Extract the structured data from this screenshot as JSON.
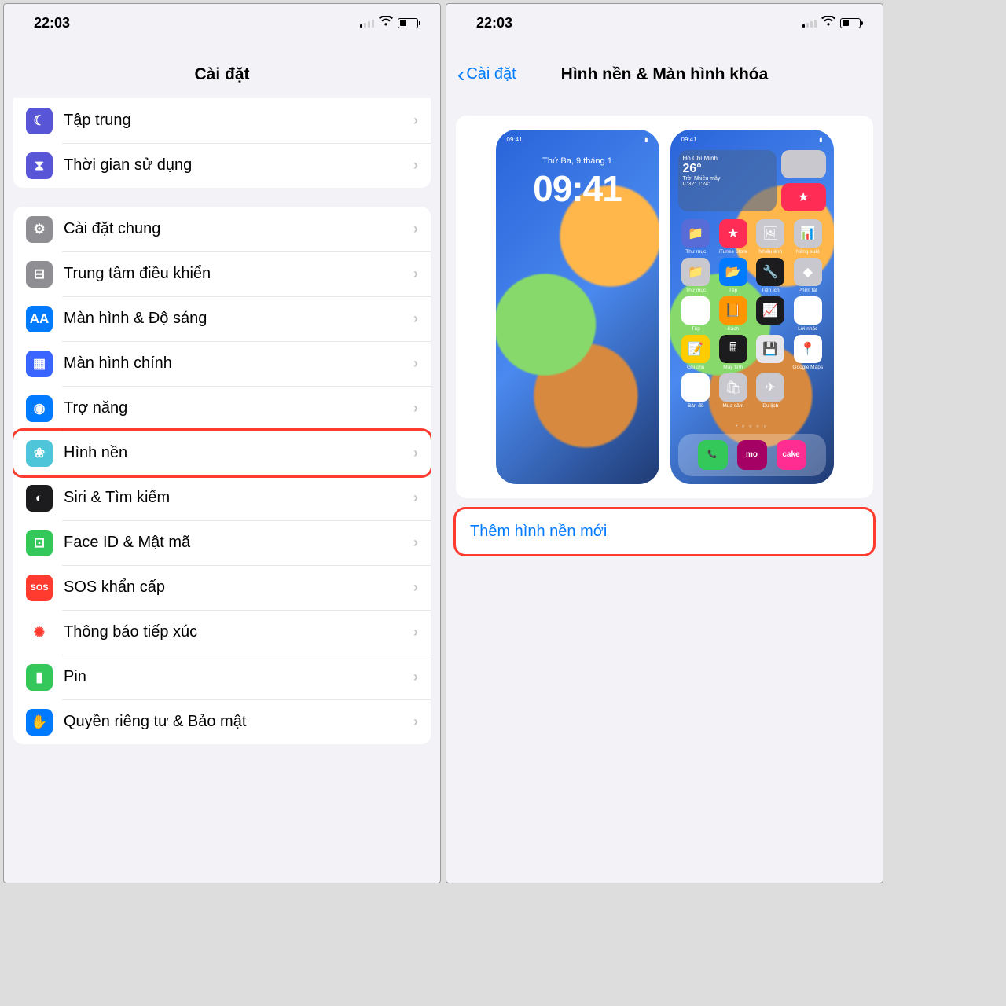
{
  "status": {
    "time": "22:03"
  },
  "left": {
    "title": "Cài đặt",
    "group1": [
      {
        "label": "Tập trung",
        "icon": "moon-icon",
        "bg": "#5856d6",
        "glyph": "☾"
      },
      {
        "label": "Thời gian sử dụng",
        "icon": "hourglass-icon",
        "bg": "#5856d6",
        "glyph": "⧗"
      }
    ],
    "group2": [
      {
        "label": "Cài đặt chung",
        "icon": "gear-icon",
        "bg": "#8e8e93",
        "glyph": "⚙"
      },
      {
        "label": "Trung tâm điều khiển",
        "icon": "switches-icon",
        "bg": "#8e8e93",
        "glyph": "⊟"
      },
      {
        "label": "Màn hình & Độ sáng",
        "icon": "text-size-icon",
        "bg": "#007aff",
        "glyph": "AA"
      },
      {
        "label": "Màn hình chính",
        "icon": "grid-icon",
        "bg": "#3a66ff",
        "glyph": "▦"
      },
      {
        "label": "Trợ năng",
        "icon": "accessibility-icon",
        "bg": "#007aff",
        "glyph": "◉"
      },
      {
        "label": "Hình nền",
        "icon": "wallpaper-icon",
        "bg": "#4fc5d9",
        "glyph": "❀",
        "highlighted": true
      },
      {
        "label": "Siri & Tìm kiếm",
        "icon": "siri-icon",
        "bg": "#1c1c1e",
        "glyph": "◐"
      },
      {
        "label": "Face ID & Mật mã",
        "icon": "faceid-icon",
        "bg": "#34c759",
        "glyph": "⊡"
      },
      {
        "label": "SOS khẩn cấp",
        "icon": "sos-icon",
        "bg": "#ff3b30",
        "glyph": "SOS"
      },
      {
        "label": "Thông báo tiếp xúc",
        "icon": "exposure-icon",
        "bg": "#ffffff",
        "glyph": "✺",
        "fg": "#ff3b30"
      },
      {
        "label": "Pin",
        "icon": "battery-icon",
        "bg": "#34c759",
        "glyph": "▮"
      },
      {
        "label": "Quyền riêng tư & Bảo mật",
        "icon": "privacy-icon",
        "bg": "#007aff",
        "glyph": "✋"
      }
    ]
  },
  "right": {
    "back": "Cài đặt",
    "title": "Hình nền & Màn hình khóa",
    "add_button": "Thêm hình nền mới",
    "lock_preview": {
      "status_time": "09:41",
      "date": "Thứ Ba, 9 tháng 1",
      "time": "09:41"
    },
    "home_preview": {
      "status_time": "09:41",
      "city": "Hồ Chí Minh",
      "temp": "26°",
      "cond": "Trời Nhiều mây",
      "range": "C:32° T:24°",
      "apps": [
        {
          "l": "Thư mục",
          "bg": "#576cd6",
          "g": "📁"
        },
        {
          "l": "iTunes Store",
          "bg": "#ff2d55",
          "g": "★"
        },
        {
          "l": "Nhiều ảnh",
          "bg": "#c8c8ce",
          "g": "🖼"
        },
        {
          "l": "Năng suất",
          "bg": "#c8c8ce",
          "g": "📊"
        },
        {
          "l": "Thư mục",
          "bg": "#c8c8ce",
          "g": "📁"
        },
        {
          "l": "Tệp",
          "bg": "#007aff",
          "g": "📂"
        },
        {
          "l": "Tiện ích",
          "bg": "#1c1c1e",
          "g": "🔧"
        },
        {
          "l": "Phím tắt",
          "bg": "#c8c8ce",
          "g": "◆"
        },
        {
          "l": "Tệp",
          "bg": "#ffffff",
          "g": "🗂"
        },
        {
          "l": "Sách",
          "bg": "#ff9500",
          "g": "📙"
        },
        {
          "l": "",
          "bg": "#1c1c1e",
          "g": "📈"
        },
        {
          "l": "Lời nhắc",
          "bg": "#ffffff",
          "g": "☰"
        },
        {
          "l": "Ghi chú",
          "bg": "#ffcc00",
          "g": "📝"
        },
        {
          "l": "Máy tính",
          "bg": "#1c1c1e",
          "g": "🖩"
        },
        {
          "l": "",
          "bg": "#e5e5ea",
          "g": "💾"
        },
        {
          "l": "Google Maps",
          "bg": "#ffffff",
          "g": "📍"
        },
        {
          "l": "Bản đồ",
          "bg": "#ffffff",
          "g": "🗺"
        },
        {
          "l": "Mua sắm",
          "bg": "#c8c8ce",
          "g": "🛍"
        },
        {
          "l": "Du lịch",
          "bg": "#c8c8ce",
          "g": "✈"
        }
      ],
      "dock": [
        {
          "bg": "#34c759",
          "g": "📞"
        },
        {
          "bg": "#a50064",
          "g": "mo"
        },
        {
          "bg": "#ff2d92",
          "g": "cake"
        }
      ]
    }
  }
}
